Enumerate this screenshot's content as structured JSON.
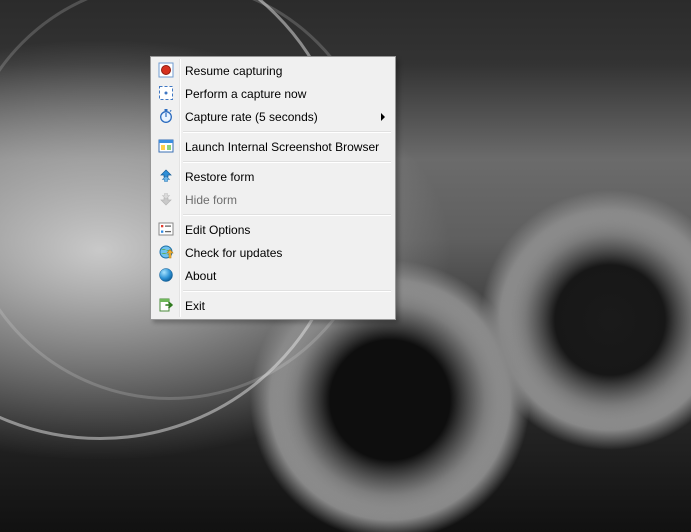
{
  "menu": {
    "items": [
      {
        "label": "Resume capturing"
      },
      {
        "label": "Perform a capture now"
      },
      {
        "label": "Capture rate (5 seconds)"
      },
      {
        "label": "Launch Internal Screenshot Browser"
      },
      {
        "label": "Restore form"
      },
      {
        "label": "Hide form"
      },
      {
        "label": "Edit Options"
      },
      {
        "label": "Check for updates"
      },
      {
        "label": "About"
      },
      {
        "label": "Exit"
      }
    ]
  }
}
